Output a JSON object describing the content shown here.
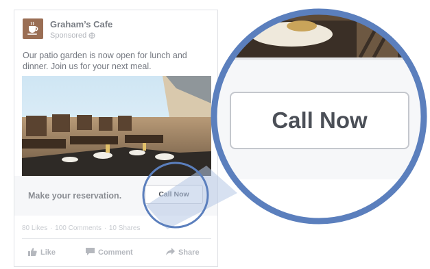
{
  "post": {
    "page_name": "Graham’s Cafe",
    "sponsored": "Sponsored",
    "text": "Our patio garden is now open for lunch and dinner. Join us for your next meal.",
    "photo_icon": "restaurant-patio-photo"
  },
  "cta": {
    "label": "Make your reservation.",
    "button_label": "Call Now"
  },
  "stats": {
    "likes": "80 Likes",
    "comments": "100 Comments",
    "shares": "10 Shares",
    "separator": "·"
  },
  "actions": {
    "like": "Like",
    "comment": "Comment",
    "share": "Share"
  },
  "zoom": {
    "button_label": "Call Now",
    "ring_color": "#5b7fbd"
  },
  "icons": {
    "avatar": "coffee-cup-icon",
    "audience": "globe-icon",
    "like": "thumbs-up-icon",
    "comment": "speech-bubble-icon",
    "share": "share-arrow-icon"
  }
}
